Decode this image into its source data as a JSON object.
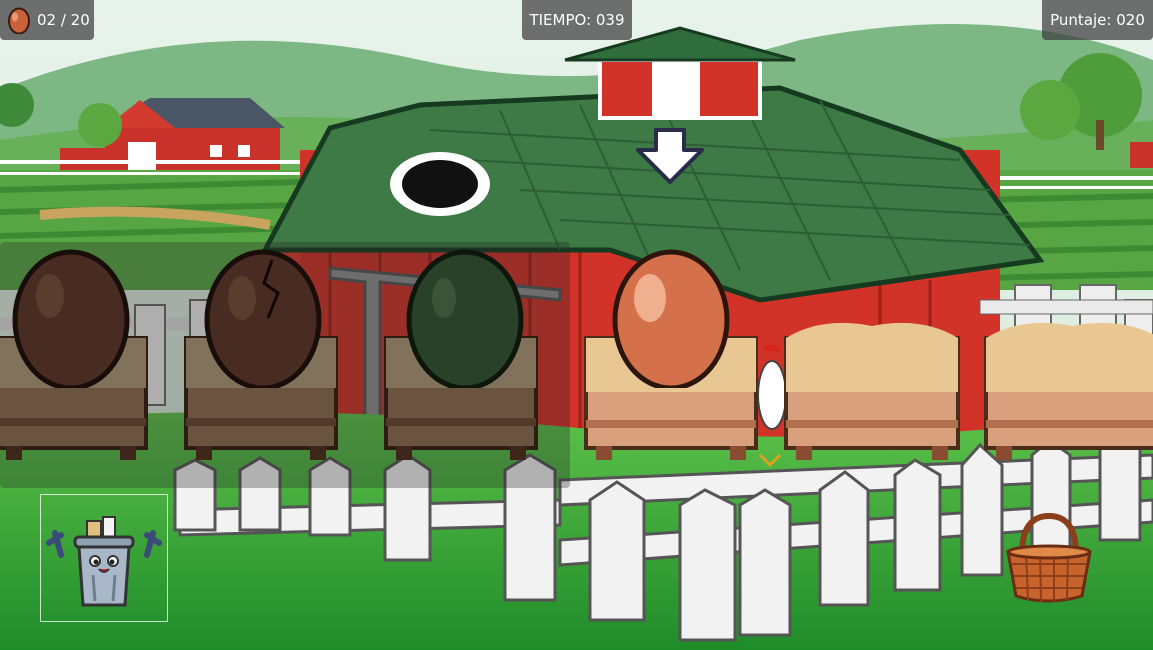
{
  "hud": {
    "eggs_label": "02 / 20",
    "time_label": "TIEMPO: 039",
    "score_label": "Puntaje: 020"
  },
  "nests": [
    {
      "egg": "brown-egg",
      "egg_color": "#7a4430",
      "state": "dimmed"
    },
    {
      "egg": "cracked-brown-egg",
      "egg_color": "#7a4430",
      "state": "dimmed"
    },
    {
      "egg": "green-egg",
      "egg_color": "#3d6b3c",
      "state": "dimmed"
    },
    {
      "egg": "orange-egg",
      "egg_color": "#d4714a",
      "state": "selected"
    },
    {
      "egg": "none",
      "state": "empty"
    },
    {
      "egg": "none",
      "state": "empty"
    }
  ],
  "icons": {
    "egg_counter": "egg-icon",
    "pointer": "down-arrow-icon",
    "trash": "trash-can-icon",
    "basket": "basket-icon"
  },
  "colors": {
    "hud_bg": "#3c3c3c",
    "barn_red": "#d8352a",
    "roof_green": "#3f7d46",
    "grass": "#34a83a",
    "sky": "#dfeee8"
  }
}
